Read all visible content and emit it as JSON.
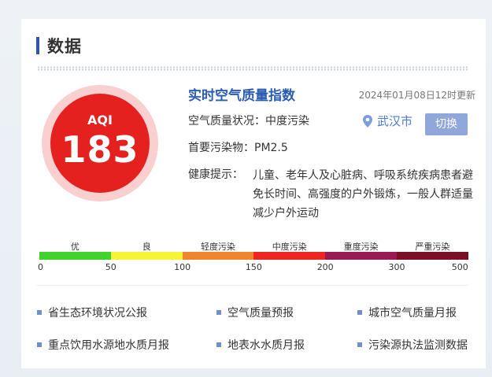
{
  "section": {
    "title": "数据"
  },
  "aqi": {
    "label": "AQI",
    "value": "183",
    "color": "#e5211f"
  },
  "info": {
    "heading": "实时空气质量指数",
    "updated": "2024年01月08日12时更新",
    "status_label": "空气质量状况：",
    "status_value": "中度污染",
    "pollutant_label": "首要污染物：",
    "pollutant_value": "PM2.5",
    "health_label": "健康提示：",
    "health_text": "儿童、老年人及心脏病、呼吸系统疾病患者避免长时间、高强度的户外锻炼，一般人群适量减少户外运动",
    "location": "武汉市",
    "switch_label": "切换"
  },
  "scale": {
    "levels": [
      {
        "label": "优",
        "color": "#3fd32c"
      },
      {
        "label": "良",
        "color": "#f6f435"
      },
      {
        "label": "轻度污染",
        "color": "#f1852b"
      },
      {
        "label": "中度污染",
        "color": "#ed2624"
      },
      {
        "label": "重度污染",
        "color": "#9a1a55"
      },
      {
        "label": "严重污染",
        "color": "#7b0f25"
      }
    ],
    "ticks": [
      "0",
      "50",
      "100",
      "150",
      "200",
      "300",
      "500"
    ]
  },
  "links": [
    "省生态环境状况公报",
    "空气质量预报",
    "城市空气质量月报",
    "重点饮用水源地水质月报",
    "地表水水质月报",
    "污染源执法监测数据"
  ]
}
